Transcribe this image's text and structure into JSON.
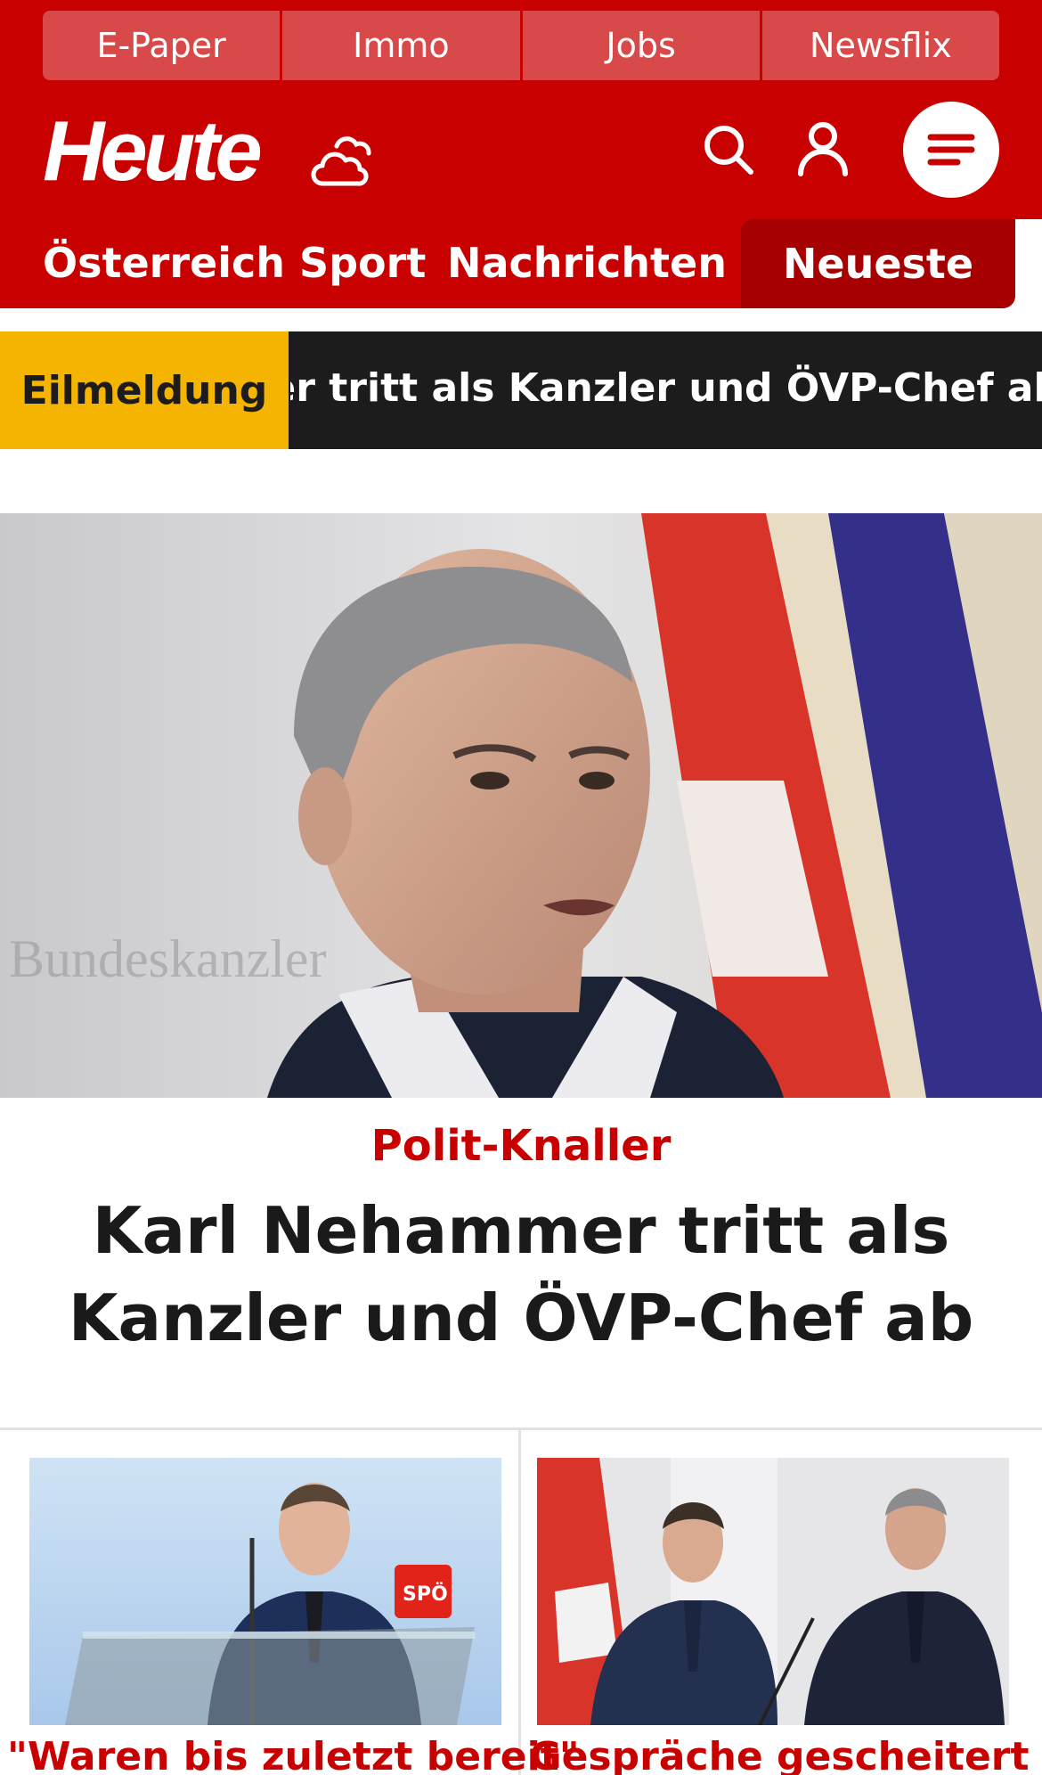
{
  "utility_nav": [
    "E-Paper",
    "Immo",
    "Jobs",
    "Newsflix"
  ],
  "brand": {
    "logo_text": "Heute",
    "color": "#c80000"
  },
  "header_icons": [
    "weather-cloud-icon",
    "search-icon",
    "user-icon",
    "menu-icon"
  ],
  "main_nav": {
    "items": [
      "Österreich",
      "Sport",
      "Nachrichten"
    ],
    "newest": "Neueste"
  },
  "ticker": {
    "label": "Eilmeldung",
    "text": "Karl Nehammer tritt als Kanzler und ÖVP-Chef ab",
    "label_color": "#f5b400"
  },
  "hero": {
    "kicker": "Polit-Knaller",
    "title": "Karl Nehammer tritt als Kanzler und ÖVP-Chef ab"
  },
  "teasers": [
    {
      "title": "\"Waren bis zuletzt bereit\"",
      "image_badge": "SPÖ"
    },
    {
      "title": "Gespräche gescheitert"
    }
  ]
}
